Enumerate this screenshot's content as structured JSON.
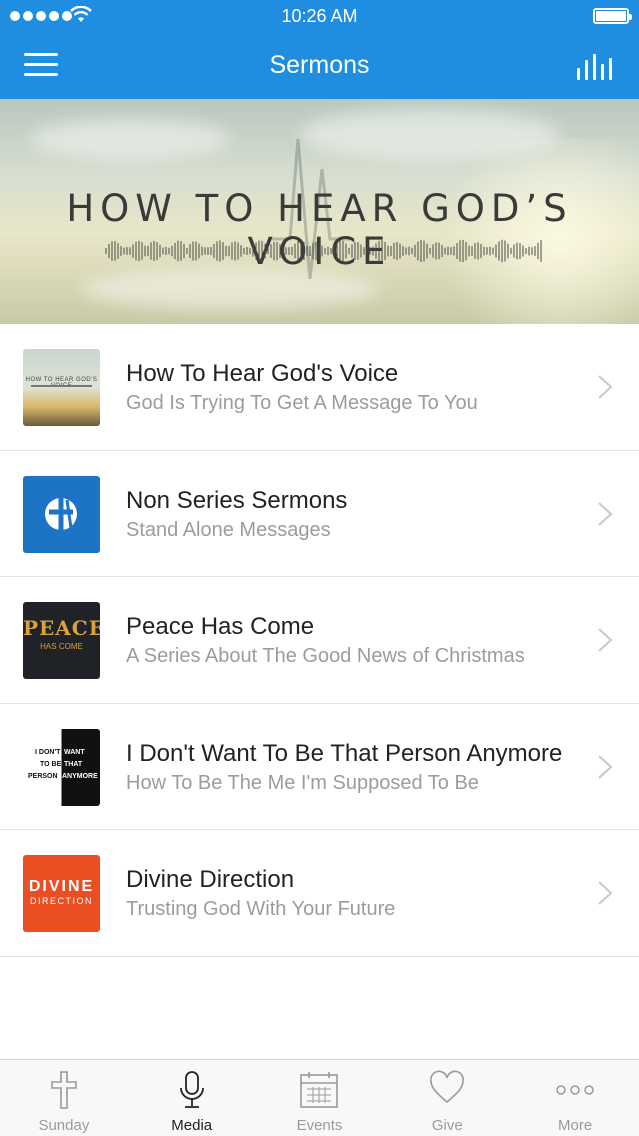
{
  "status_bar": {
    "time": "10:26 AM"
  },
  "nav": {
    "title": "Sermons"
  },
  "hero": {
    "title": "HOW TO HEAR GOD’S VOICE"
  },
  "series": [
    {
      "title": "How To Hear God's Voice",
      "subtitle": "God Is Trying To Get A Message To You",
      "thumb_text": "HOW TO HEAR GOD'S VOICE"
    },
    {
      "title": "Non Series Sermons",
      "subtitle": "Stand Alone Messages"
    },
    {
      "title": "Peace Has Come",
      "subtitle": "A Series About The Good News of Christmas",
      "thumb_text": "PEACE",
      "thumb_sub": "HAS COME"
    },
    {
      "title": "I Don't Want To Be That Person Anymore",
      "subtitle": "How To Be The Me I'm Supposed To Be",
      "thumb_lines": [
        "I DON'T",
        "WANT",
        "TO BE",
        "THAT",
        "PERSON",
        "ANYMORE"
      ]
    },
    {
      "title": "Divine Direction",
      "subtitle": "Trusting God With Your Future",
      "thumb_text": "DIVINE",
      "thumb_sub": "DIRECTION"
    }
  ],
  "tabs": [
    {
      "label": "Sunday",
      "icon": "cross-icon"
    },
    {
      "label": "Media",
      "icon": "microphone-icon",
      "active": true
    },
    {
      "label": "Events",
      "icon": "calendar-icon"
    },
    {
      "label": "Give",
      "icon": "heart-icon"
    },
    {
      "label": "More",
      "icon": "more-dots-icon"
    }
  ],
  "colors": {
    "nav_blue": "#1f8ee0",
    "subtitle_gray": "#9c9c9c",
    "divine_orange": "#ea4e23",
    "nonseries_blue": "#1d73c4"
  }
}
